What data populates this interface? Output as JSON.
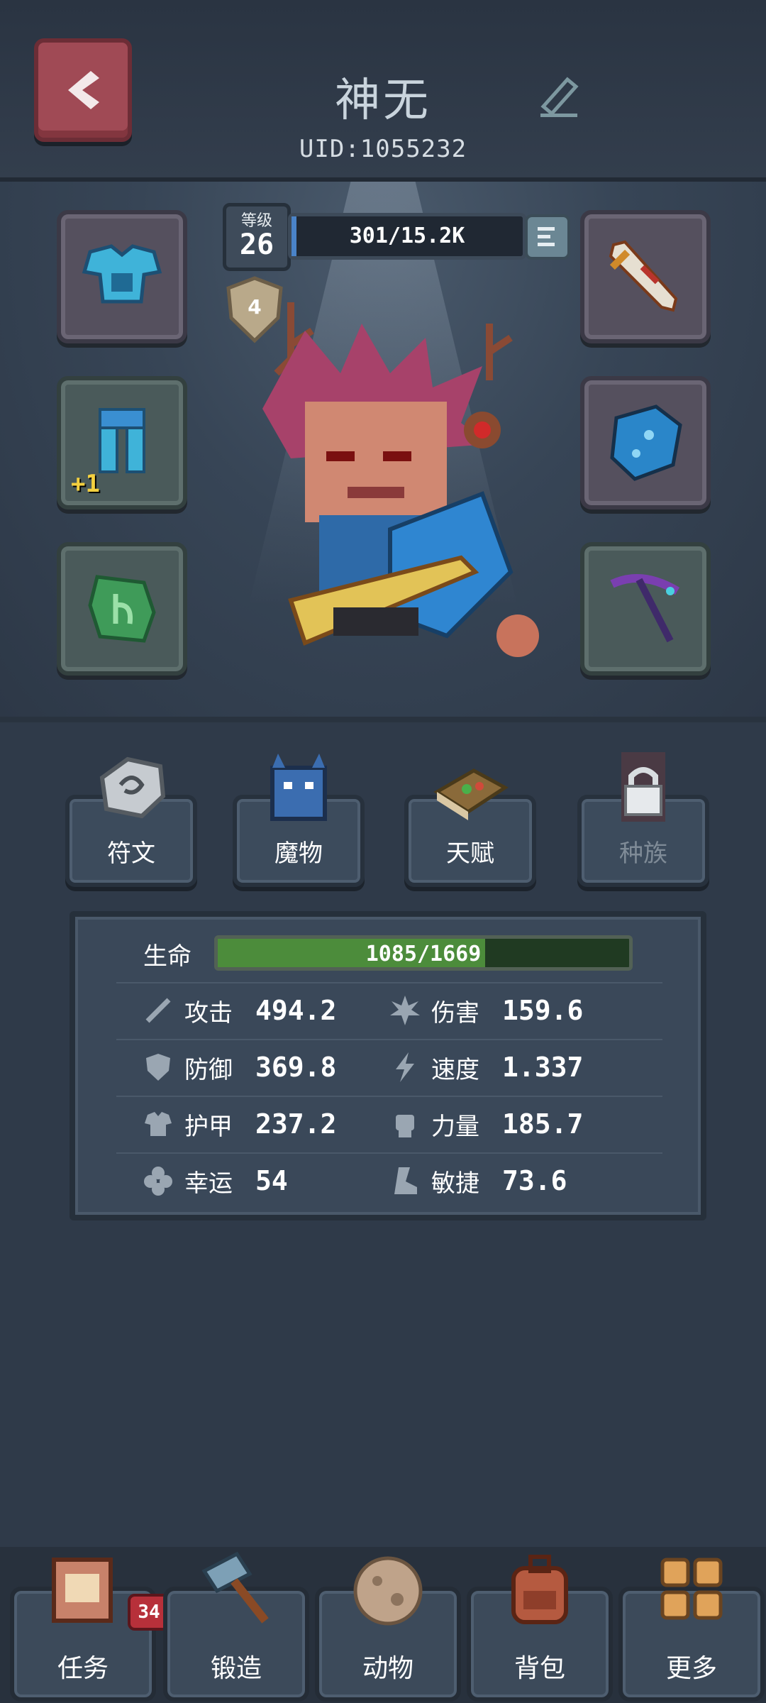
{
  "header": {
    "name": "神无",
    "uid": "UID:1055232"
  },
  "player": {
    "level_label": "等级",
    "level": "26",
    "exp": "301/15.2K",
    "exp_fraction": 0.02,
    "rank": "4"
  },
  "slots": {
    "left_2_bonus": "+1"
  },
  "features": [
    {
      "label": "符文",
      "locked": false
    },
    {
      "label": "魔物",
      "locked": false
    },
    {
      "label": "天赋",
      "locked": false
    },
    {
      "label": "种族",
      "locked": true
    }
  ],
  "stats": {
    "hp_label": "生命",
    "hp_text": "1085/1669",
    "hp_fraction": 0.65,
    "rows": [
      {
        "label": "攻击",
        "value": "494.2",
        "icon": "sword-icon"
      },
      {
        "label": "伤害",
        "value": "159.6",
        "icon": "burst-icon"
      },
      {
        "label": "防御",
        "value": "369.8",
        "icon": "shield-icon"
      },
      {
        "label": "速度",
        "value": "1.337",
        "icon": "lightning-icon"
      },
      {
        "label": "护甲",
        "value": "237.2",
        "icon": "armor-icon"
      },
      {
        "label": "力量",
        "value": "185.7",
        "icon": "fist-icon"
      },
      {
        "label": "幸运",
        "value": "54",
        "icon": "clover-icon"
      },
      {
        "label": "敏捷",
        "value": "73.6",
        "icon": "boot-icon"
      }
    ]
  },
  "nav": {
    "items": [
      {
        "label": "任务",
        "badge": "34"
      },
      {
        "label": "锻造"
      },
      {
        "label": "动物"
      },
      {
        "label": "背包"
      },
      {
        "label": "更多"
      }
    ]
  },
  "colors": {
    "accent_red": "#a04a55",
    "hp_green": "#4c8c3b",
    "exp_blue": "#4a83c8"
  }
}
